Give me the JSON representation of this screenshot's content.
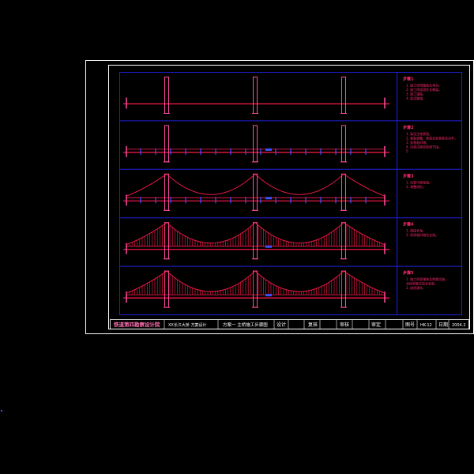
{
  "colors": {
    "background": "#000000",
    "frame": "#ffffff",
    "grid": "#2020d8",
    "structure": "#ff1a4a",
    "pier": "#ff4da0",
    "blue_parts": "#3b52ff",
    "text": "#ffffff",
    "notes": "#ff2a6a"
  },
  "stages": [
    {
      "id": "stage-1",
      "head": "步骤1",
      "notes": [
        "1. 施工桥塔基础及承台。",
        "2. 施工桥塔塔柱及横梁。",
        "3. 施工锚碇。",
        "4. 架设猫道。"
      ],
      "cable": false,
      "hangers": "none",
      "segments": false
    },
    {
      "id": "stage-2",
      "head": "步骤2",
      "notes": [
        "1. 架设主缆索股。",
        "2. 索股调整，紧缆及安装索夹吊杆。",
        "3. 安装临时墩。",
        "4. 吊装边跨加劲梁节段。",
        "5."
      ],
      "cable": false,
      "hangers": "none",
      "segments": true
    },
    {
      "id": "stage-3",
      "head": "步骤3",
      "notes": [
        "1. 吊装中跨梁段。",
        "2. 调整线形。"
      ],
      "cable": true,
      "hangers": "none",
      "segments": true
    },
    {
      "id": "stage-4",
      "head": "步骤4",
      "notes": [
        "1. 梁段合龙。",
        "2. 拆除临时墩及支架。"
      ],
      "cable": true,
      "hangers": "dense",
      "segments": false
    },
    {
      "id": "stage-5",
      "head": "步骤5",
      "notes": [
        "1. 施工桥面铺装及附属设施，",
        "   全桥荷载试验及验收。",
        "2. 成桥通车。"
      ],
      "cable": true,
      "hangers": "dense",
      "segments": false
    }
  ],
  "title_block": {
    "company": "铁道第四勘察设计院",
    "project": "XX长江大桥 方案设计",
    "drawing_title": "方案一 主桥施工步骤图",
    "designed_label": "设计",
    "checked_label": "复核",
    "reviewed_label": "审核",
    "approved_label": "审定",
    "drawing_no_label": "图号",
    "drawing_no": "HK-12",
    "date_label": "日期",
    "date": "2004.2"
  }
}
